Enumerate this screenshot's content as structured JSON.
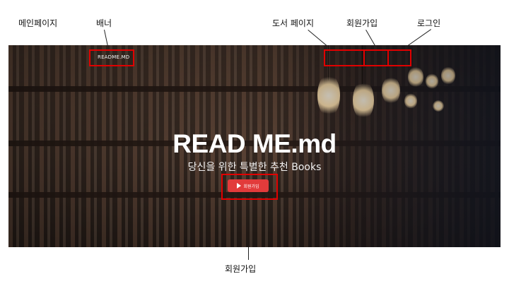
{
  "annotations": {
    "main_page": "메인페이지",
    "banner": "배너",
    "book_page": "도서 페이지",
    "signup_top": "회원가입",
    "login": "로그인",
    "signup_bottom": "회원가입"
  },
  "hero": {
    "brand": "README.MD",
    "title": "READ ME.md",
    "subtitle": "당신을 위한 특별한 추천 Books",
    "cta_label": "회원가입"
  },
  "colors": {
    "highlight": "#e00000",
    "cta": "#e23b3b"
  }
}
